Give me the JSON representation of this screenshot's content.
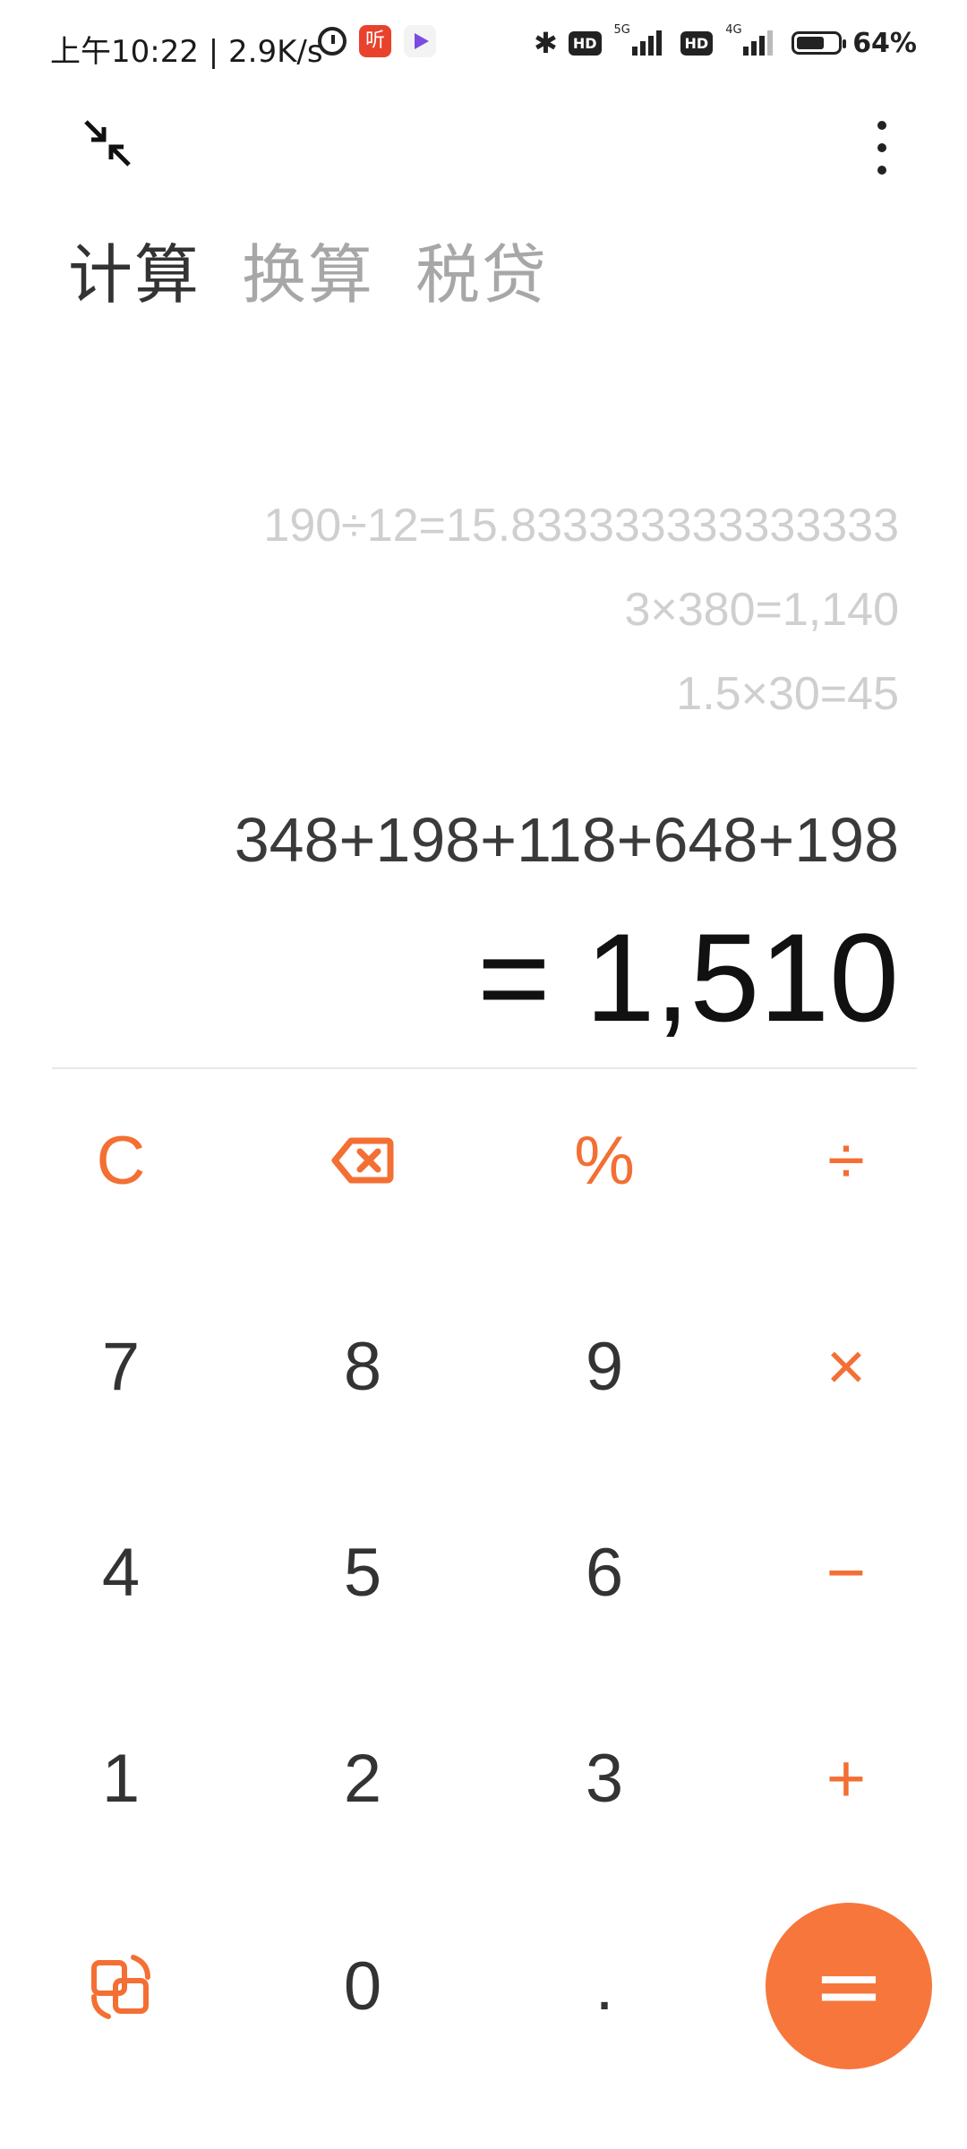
{
  "status_bar": {
    "time_speed": "上午10:22 | 2.9K/s",
    "app_ting_label": "听",
    "net_5g": "5G",
    "net_4g": "4G",
    "hd1": "HD",
    "hd2": "HD",
    "battery_pct": "64%"
  },
  "tabs": [
    "计算",
    "换算",
    "税贷"
  ],
  "history": [
    "190÷12=15.833333333333333",
    "3×380=1,140",
    "1.5×30=45"
  ],
  "expression": "348+198+118+648+198",
  "result": "= 1,510",
  "keys": {
    "clear": "C",
    "percent": "%",
    "divide": "÷",
    "k7": "7",
    "k8": "8",
    "k9": "9",
    "multiply": "×",
    "k4": "4",
    "k5": "5",
    "k6": "6",
    "minus": "−",
    "k1": "1",
    "k2": "2",
    "k3": "3",
    "plus": "+",
    "k0": "0",
    "dot": ".",
    "equals": "="
  },
  "accent_color": "#f36f33",
  "icons": {
    "collapse": "collapse-arrows-icon",
    "menu": "more-vertical-icon",
    "backspace": "backspace-icon",
    "switch": "switch-mode-icon"
  }
}
